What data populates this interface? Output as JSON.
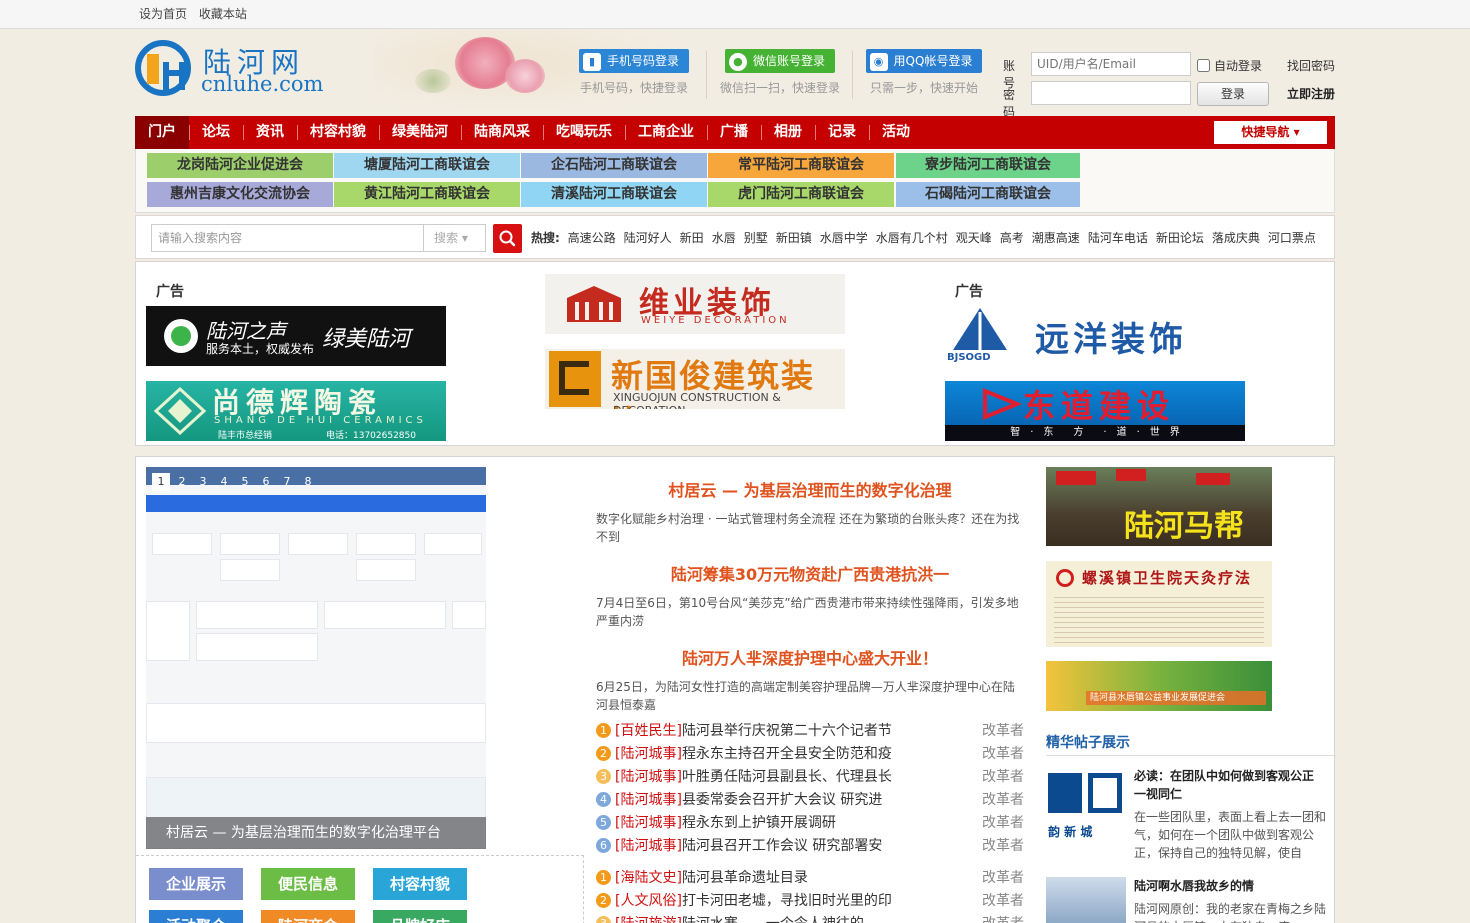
{
  "topbar": {
    "set_home": "设为首页",
    "bookmark": "收藏本站"
  },
  "logo": {
    "cn": "陆河网",
    "en": "cnluhe.com"
  },
  "login": {
    "phone": {
      "label": "手机号码登录",
      "sub": "手机号码，快捷登录"
    },
    "wechat": {
      "label": "微信账号登录",
      "sub": "微信扫一扫，快速登录"
    },
    "qq": {
      "label": "用QQ帐号登录",
      "sub": "只需一步，快速开始"
    }
  },
  "account": {
    "user_label": "账号",
    "user_placeholder": "UID/用户名/Email",
    "pass_label": "密码",
    "auto_login": "自动登录",
    "login_button": "登录",
    "forgot": "找回密码",
    "register": "立即注册"
  },
  "nav": {
    "items": [
      "门户",
      "论坛",
      "资讯",
      "村容村貌",
      "绿美陆河",
      "陆商风采",
      "吃喝玩乐",
      "工商企业",
      "广播",
      "相册",
      "记录",
      "活动"
    ],
    "quick": "快捷导航"
  },
  "associations": [
    {
      "label": "龙岗陆河企业促进会",
      "color": "#9ccf6b"
    },
    {
      "label": "塘厦陆河工商联谊会",
      "color": "#9fd6f0"
    },
    {
      "label": "企石陆河工商联谊会",
      "color": "#9bb8e0"
    },
    {
      "label": "常平陆河工商联谊会",
      "color": "#f7a63c"
    },
    {
      "label": "寮步陆河工商联谊会",
      "color": "#6ed38a"
    },
    {
      "label": "惠州吉康文化交流协会",
      "color": "#a7a9d8"
    },
    {
      "label": "黄江陆河工商联谊会",
      "color": "#a8d86a"
    },
    {
      "label": "清溪陆河工商联谊会",
      "color": "#90d6f4"
    },
    {
      "label": "虎门陆河工商联谊会",
      "color": "#a8d86a"
    },
    {
      "label": "石碣陆河工商联谊会",
      "color": "#9bbfe8"
    }
  ],
  "search": {
    "placeholder": "请输入搜索内容",
    "scope": "搜索",
    "hot_label": "热搜:",
    "hot": [
      "高速公路",
      "陆河好人",
      "新田",
      "水唇",
      "别墅",
      "新田镇",
      "水唇中学",
      "水唇有几个村",
      "观天峰",
      "高考",
      "潮惠高速",
      "陆河车电话",
      "新田论坛",
      "落成庆典",
      "河口票点"
    ]
  },
  "ads": {
    "label": "广告",
    "items": [
      {
        "title": "陆河之声",
        "sub": "服务本土，权威发布",
        "slogan": "绿美陆河"
      },
      {
        "title": "维业装饰",
        "sub": "WEIYE DECORATION"
      },
      {
        "title": "远洋装饰",
        "sub": "BJSOGD"
      },
      {
        "title": "尚德辉陶瓷",
        "sub": "SHANG DE HUI CERAMICS",
        "note": "陆丰市总经销",
        "phone": "电话：13702652850"
      },
      {
        "title": "新国俊建筑装饰",
        "sub": "XINGUOJUN CONSTRUCTION & DECORATION"
      },
      {
        "title": "东道建设",
        "sub": "智　·　东　　方　　·　道　·　世　界"
      }
    ]
  },
  "slider": {
    "pages": [
      "1",
      "2",
      "3",
      "4",
      "5",
      "6",
      "7",
      "8"
    ],
    "caption": "村居云 — 为基层治理而生的数字化治理平台"
  },
  "tiles": [
    {
      "label": "企业展示",
      "color": "#7a8dcc"
    },
    {
      "label": "便民信息",
      "color": "#6cbd45"
    },
    {
      "label": "村容村貌",
      "color": "#2aa5d8"
    },
    {
      "label": "活动聚合",
      "color": "#2a7fd4"
    },
    {
      "label": "陆河商会",
      "color": "#f08a24"
    },
    {
      "label": "品牌好店",
      "color": "#39a860"
    }
  ],
  "headlines": [
    {
      "title": "村居云 — 为基层治理而生的数字化治理",
      "desc": "数字化赋能乡村治理 · 一站式管理村务全流程 还在为繁琐的台账头疼？还在为找不到"
    },
    {
      "title": "陆河筹集30万元物资赴广西贵港抗洪一",
      "desc": "7月4日至6日，第10号台风“美莎克”给广西贵港市带来持续性强降雨，引发多地严重内涝"
    },
    {
      "title": "陆河万人芈深度护理中心盛大开业！",
      "desc": "6月25日，为陆河女性打造的高端定制美容护理品牌—万人芈深度护理中心在陆河县恒泰嘉"
    }
  ],
  "list1": [
    {
      "cat": "[百姓民生]",
      "title": "陆河县举行庆祝第二十六个记者节",
      "author": "改革者"
    },
    {
      "cat": "[陆河城事]",
      "title": "程永东主持召开全县安全防范和疫",
      "author": "改革者"
    },
    {
      "cat": "[陆河城事]",
      "title": "叶胜勇任陆河县副县长、代理县长",
      "author": "改革者"
    },
    {
      "cat": "[陆河城事]",
      "title": "县委常委会召开扩大会议 研究进",
      "author": "改革者"
    },
    {
      "cat": "[陆河城事]",
      "title": "程永东到上护镇开展调研",
      "author": "改革者"
    },
    {
      "cat": "[陆河城事]",
      "title": "陆河县召开工作会议 研究部署安",
      "author": "改革者"
    }
  ],
  "list2": [
    {
      "cat": "[海陆文史]",
      "title": "陆河县革命遗址目录",
      "author": "改革者"
    },
    {
      "cat": "[人文风俗]",
      "title": "打卡河田老墟，寻找旧时光里的印",
      "author": "改革者"
    },
    {
      "cat": "[陆河旅游]",
      "title": "陆河水寨……一个令人神往的",
      "author": "改革者"
    }
  ],
  "right": {
    "img1": "陆河马帮",
    "img2": "螺溪镇卫生院天灸疗法",
    "img3": "陆河县水唇镇公益事业发展促进会",
    "section": "精华帖子展示",
    "posts": [
      {
        "title": "必读：在团队中如何做到客观公正一视同仁",
        "text": "在一些团队里，表面上看上去一团和气，如何在一个团队中做到客观公正，保持自己的独特见解，使自",
        "img": "韵 新 城"
      },
      {
        "title": "陆河啊水唇我故乡的情",
        "text": "陆河网原创：我的老家在青梅之乡陆河县的水唇镇，占有独自一座..."
      }
    ]
  }
}
